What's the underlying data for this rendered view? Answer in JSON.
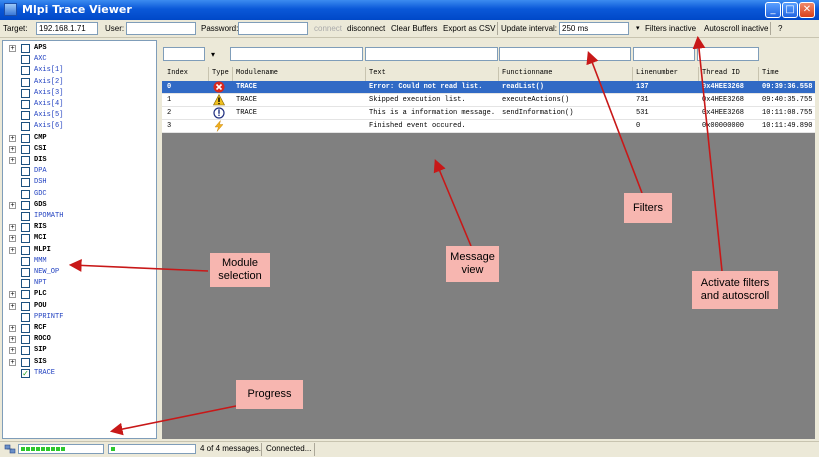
{
  "window": {
    "title": "Mlpi Trace Viewer"
  },
  "toolbar": {
    "target_label": "Target:",
    "target_value": "192.168.1.71",
    "user_label": "User:",
    "user_value": "",
    "password_label": "Password:",
    "password_value": "",
    "connect_label": "connect",
    "disconnect_label": "disconnect",
    "clear_label": "Clear Buffers",
    "export_label": "Export as CSV",
    "interval_label": "Update interval:",
    "interval_value": "250 ms",
    "filters_label": "Filters inactive",
    "autoscroll_label": "Autoscroll inactive",
    "help_label": "?"
  },
  "tree": {
    "items": [
      {
        "label": "APS",
        "expandable": true,
        "checked": false,
        "style": "bold"
      },
      {
        "label": "AXC",
        "expandable": false,
        "checked": false,
        "style": "blue"
      },
      {
        "label": "Axis[1]",
        "expandable": false,
        "checked": false,
        "style": "blue"
      },
      {
        "label": "Axis[2]",
        "expandable": false,
        "checked": false,
        "style": "blue"
      },
      {
        "label": "Axis[3]",
        "expandable": false,
        "checked": false,
        "style": "blue"
      },
      {
        "label": "Axis[4]",
        "expandable": false,
        "checked": false,
        "style": "blue"
      },
      {
        "label": "Axis[5]",
        "expandable": false,
        "checked": false,
        "style": "blue"
      },
      {
        "label": "Axis[6]",
        "expandable": false,
        "checked": false,
        "style": "blue"
      },
      {
        "label": "CMP",
        "expandable": true,
        "checked": false,
        "style": "bold"
      },
      {
        "label": "CSI",
        "expandable": true,
        "checked": false,
        "style": "bold"
      },
      {
        "label": "DIS",
        "expandable": true,
        "checked": false,
        "style": "bold"
      },
      {
        "label": "DPA",
        "expandable": false,
        "checked": false,
        "style": "blue"
      },
      {
        "label": "DSH",
        "expandable": false,
        "checked": false,
        "style": "blue"
      },
      {
        "label": "GDC",
        "expandable": false,
        "checked": false,
        "style": "blue"
      },
      {
        "label": "GDS",
        "expandable": true,
        "checked": false,
        "style": "bold"
      },
      {
        "label": "IPOMATH",
        "expandable": false,
        "checked": false,
        "style": "blue"
      },
      {
        "label": "RIS",
        "expandable": true,
        "checked": false,
        "style": "bold"
      },
      {
        "label": "MCI",
        "expandable": true,
        "checked": false,
        "style": "bold"
      },
      {
        "label": "MLPI",
        "expandable": true,
        "checked": false,
        "style": "bold"
      },
      {
        "label": "MMM",
        "expandable": false,
        "checked": false,
        "style": "blue"
      },
      {
        "label": "NEW_OP",
        "expandable": false,
        "checked": false,
        "style": "blue"
      },
      {
        "label": "NPT",
        "expandable": false,
        "checked": false,
        "style": "blue"
      },
      {
        "label": "PLC",
        "expandable": true,
        "checked": false,
        "style": "bold"
      },
      {
        "label": "POU",
        "expandable": true,
        "checked": false,
        "style": "bold"
      },
      {
        "label": "PPRINTF",
        "expandable": false,
        "checked": false,
        "style": "blue"
      },
      {
        "label": "RCF",
        "expandable": true,
        "checked": false,
        "style": "bold"
      },
      {
        "label": "ROCO",
        "expandable": true,
        "checked": false,
        "style": "bold"
      },
      {
        "label": "SIP",
        "expandable": true,
        "checked": false,
        "style": "bold"
      },
      {
        "label": "SIS",
        "expandable": true,
        "checked": false,
        "style": "bold"
      },
      {
        "label": "TRACE",
        "expandable": false,
        "checked": true,
        "style": "blue"
      }
    ]
  },
  "filters": {
    "type_dropdown": "▾"
  },
  "table": {
    "columns": [
      "Index",
      "Type",
      "Modulename",
      "Text",
      "Functionname",
      "Linenumber",
      "Thread ID",
      "Time"
    ],
    "rows": [
      {
        "index": "0",
        "type": "error",
        "module": "TRACE",
        "text": "Error: Could not read list.",
        "function": "readList()",
        "line": "137",
        "thread": "0x4HEE3268",
        "time": "09:39:36.558",
        "selected": true
      },
      {
        "index": "1",
        "type": "warning",
        "module": "TRACE",
        "text": "Skipped execution list.",
        "function": "executeActions()",
        "line": "731",
        "thread": "0x4HEE3268",
        "time": "09:40:35.755",
        "selected": false
      },
      {
        "index": "2",
        "type": "info",
        "module": "TRACE",
        "text": "This is a information message.",
        "function": "sendInformation()",
        "line": "531",
        "thread": "0x4HEE3268",
        "time": "10:11:08.755",
        "selected": false
      },
      {
        "index": "3",
        "type": "event",
        "module": "",
        "text": "Finished event occured.",
        "function": "",
        "line": "0",
        "thread": "0x00000000",
        "time": "10:11:49.890",
        "selected": false
      }
    ]
  },
  "status": {
    "progress1": 0.55,
    "progress2": 0.05,
    "messages": "4 of 4 messages.",
    "connection": "Connected..."
  },
  "annotations": {
    "module_selection": "Module selection",
    "message_view": "Message view",
    "filters": "Filters",
    "activate": "Activate filters and autoscroll",
    "progress": "Progress"
  },
  "colors": {
    "callout": "#f7b6b0",
    "arrow": "#c81818",
    "selection": "#316ac5"
  },
  "icons": {
    "error": "error-icon",
    "warning": "warning-icon",
    "info": "info-icon",
    "event": "lightning-icon"
  }
}
